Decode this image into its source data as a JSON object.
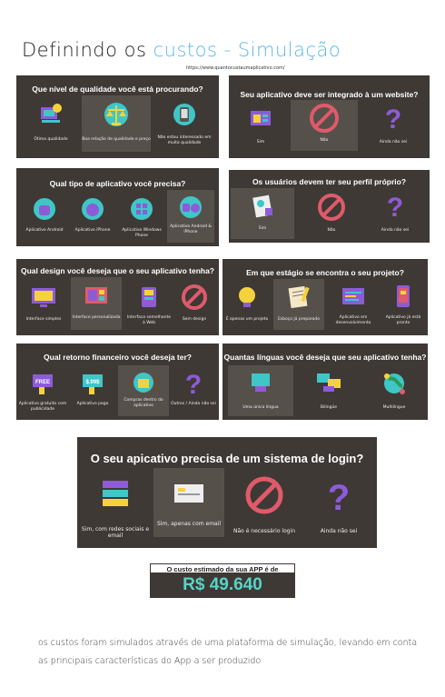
{
  "title": {
    "prefix": "Definindo os ",
    "accent": "custos - Simulação"
  },
  "source_url": "https://www.quantocustaumaplicativo.com/",
  "panels": {
    "quality": {
      "question": "Que nível de qualidade você está procurando?",
      "options": [
        "Ótima qualidade",
        "Boa relação de qualidade e preço",
        "Não estou interessado em muita qualidade"
      ]
    },
    "website": {
      "question": "Seu aplicativo deve ser integrado à um website?",
      "options": [
        "Sim",
        "Não",
        "Ainda não sei"
      ]
    },
    "platform": {
      "question": "Qual tipo de aplicativo você precisa?",
      "options": [
        "Aplicativo Android",
        "Aplicativo iPhone",
        "Aplicativo Windows Phone",
        "Aplicativo Android & iPhone"
      ]
    },
    "profile": {
      "question": "Os usuários devem ter seu perfil próprio?",
      "options": [
        "Sim",
        "Não",
        "Ainda não sei"
      ]
    },
    "design": {
      "question": "Qual design você deseja que o seu aplicativo tenha?",
      "options": [
        "Interface simples",
        "Interface personalizada",
        "Interface semelhante à Web",
        "Sem design"
      ]
    },
    "stage": {
      "question": "Em que estágio se encontra o seu projeto?",
      "options": [
        "É apenas um projeto",
        "Esboço já preparado",
        "Aplicativo em desenvolvimento",
        "Aplicativo já está pronto"
      ]
    },
    "revenue": {
      "question": "Qual retorno financeiro você deseja ter?",
      "options": [
        "Aplicativo gratuito com publicidade",
        "Aplicativo pago",
        "Compras dentro do aplicativo",
        "Outros / Ainda não sei"
      ],
      "badges": [
        "FREE",
        "$.99$"
      ]
    },
    "languages": {
      "question": "Quantas línguas você deseja que seu aplicativo tenha?",
      "options": [
        "Uma única língua",
        "Bilíngüe",
        "Multilíngue"
      ]
    },
    "login": {
      "question": "O seu apicativo precisa de um sistema de login?",
      "options": [
        "Sim, com redes sociais e email",
        "Sim, apenas com email",
        "Não é necessário login",
        "Ainda não sei"
      ]
    }
  },
  "cost": {
    "label": "O custo estimado da sua APP é de",
    "value": "R$ 49.640"
  },
  "note": "os custos foram simulados através de uma plataforma de simulação, levando em conta as principais características do App a ser produzido",
  "colors": {
    "panel": "#3e3935",
    "selected": "#56504b",
    "accent": "#5bb8e8",
    "cost_value": "#57d4c8",
    "purple": "#8e5bd8",
    "teal": "#3fc6c6",
    "yellow": "#f5d23c",
    "red": "#e05a6a"
  }
}
